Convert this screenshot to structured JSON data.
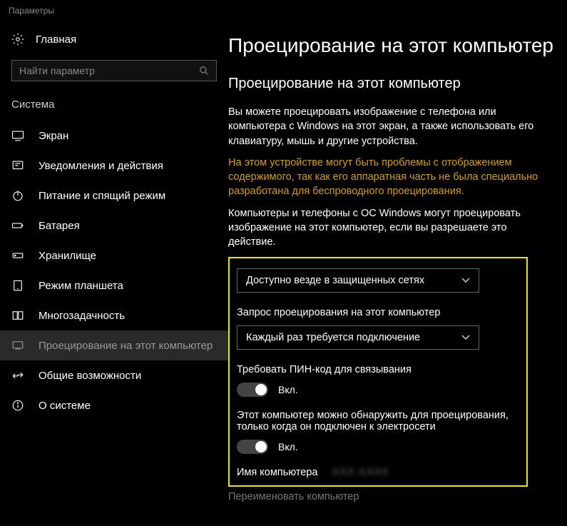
{
  "titlebar": "Параметры",
  "sidebar": {
    "home": "Главная",
    "search_placeholder": "Найти параметр",
    "section": "Система",
    "items": [
      {
        "label": "Экран"
      },
      {
        "label": "Уведомления и действия"
      },
      {
        "label": "Питание и спящий режим"
      },
      {
        "label": "Батарея"
      },
      {
        "label": "Хранилище"
      },
      {
        "label": "Режим планшета"
      },
      {
        "label": "Многозадачность"
      },
      {
        "label": "Проецирование на этот компьютер"
      },
      {
        "label": "Общие возможности"
      },
      {
        "label": "О системе"
      }
    ]
  },
  "main": {
    "title": "Проецирование на этот компьютер",
    "subtitle": "Проецирование на этот компьютер",
    "desc": "Вы можете проецировать изображение с телефона или компьютера с Windows на этот экран, а также использовать его клавиатуру, мышь и другие устройства.",
    "warning": "На этом устройстве могут быть проблемы с отображением содержимого, так как его аппаратная часть не была специально разработана для беспроводного проецирования.",
    "desc2": "Компьютеры и телефоны с ОС Windows могут проецировать изображение на этот компьютер, если вы разрешаете это действие.",
    "dropdown1_value": "Доступно везде в защищенных сетях",
    "setting2_label": "Запрос проецирования на этот компьютер",
    "dropdown2_value": "Каждый раз требуется подключение",
    "setting3_label": "Требовать ПИН-код для связывания",
    "toggle3_state": "Вкл.",
    "setting4_label": "Этот компьютер можно обнаружить для проецирования, только когда он подключен к электросети",
    "toggle4_state": "Вкл.",
    "pc_name_label": "Имя компьютера",
    "pc_name_value": "XXX-XXXX",
    "rename_link": "Переименовать компьютер"
  }
}
